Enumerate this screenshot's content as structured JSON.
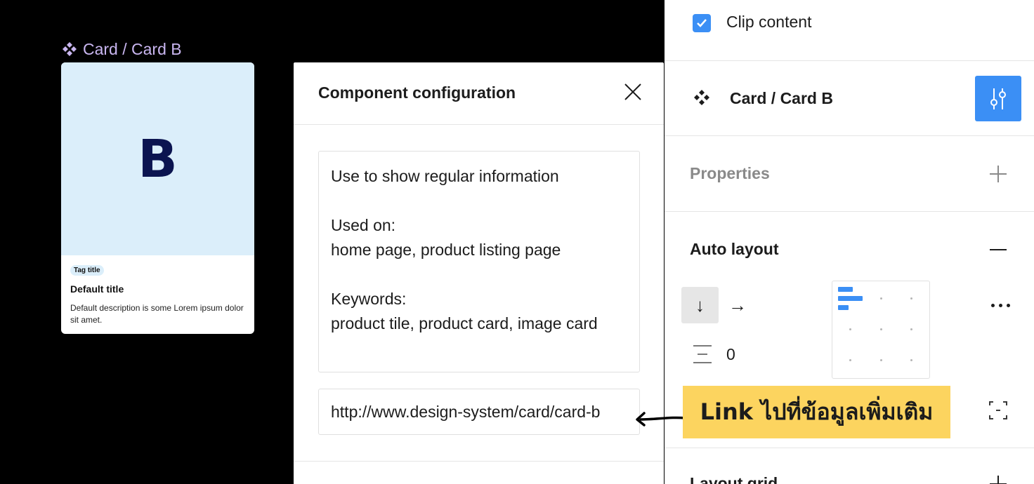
{
  "canvas": {
    "frame_label": "Card / Card B",
    "card": {
      "letter": "B",
      "tag": "Tag title",
      "title": "Default title",
      "description": "Default description is some Lorem ipsum dolor sit amet."
    }
  },
  "modal": {
    "title": "Component configuration",
    "description_lines": [
      "Use to show regular information",
      "",
      "Used on:",
      "home page, product listing page",
      "",
      "Keywords:",
      "product tile, product card, image card"
    ],
    "link_value": "http://www.design-system/card/card-b"
  },
  "panel": {
    "clip_content": {
      "label": "Clip content",
      "checked": true
    },
    "instance_name": "Card / Card B",
    "properties_label": "Properties",
    "auto_layout": {
      "label": "Auto layout",
      "direction": "vertical",
      "spacing": "0",
      "alignment": "top-left"
    },
    "layout_grid_label": "Layout grid"
  },
  "annotation": {
    "text": "Link ไปที่ข้อมูลเพิ่มเติม",
    "color": "#fcd45f"
  },
  "colors": {
    "accent": "#3b8ff5",
    "card_image_bg": "#dbeefa",
    "card_letter": "#0b1450",
    "frame_label": "#c9b6f0"
  },
  "icons": [
    "component-icon",
    "close-icon",
    "checkbox-check-icon",
    "instance-icon",
    "sliders-icon",
    "plus-icon",
    "minus-icon",
    "arrow-down-icon",
    "arrow-right-icon",
    "more-icon",
    "spacing-icon",
    "padding-icon",
    "curved-arrow-icon"
  ]
}
